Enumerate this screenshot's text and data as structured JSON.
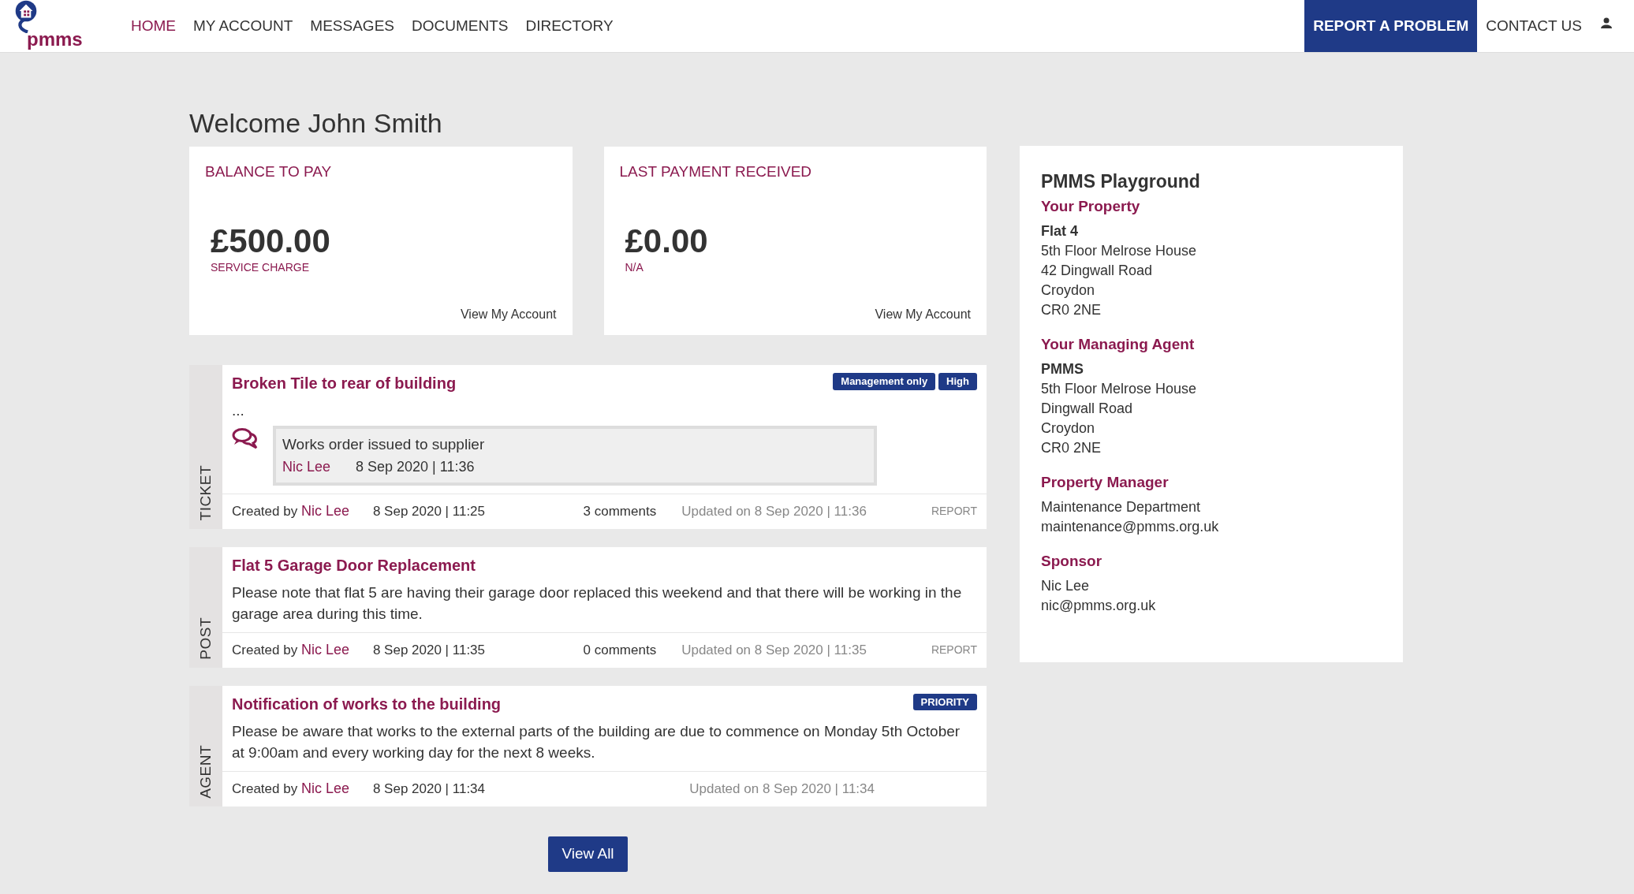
{
  "header": {
    "logo_text": "pmms",
    "nav": [
      {
        "label": "HOME",
        "selected": true
      },
      {
        "label": "MY ACCOUNT",
        "selected": false
      },
      {
        "label": "MESSAGES",
        "selected": false
      },
      {
        "label": "DOCUMENTS",
        "selected": false
      },
      {
        "label": "DIRECTORY",
        "selected": false
      }
    ],
    "report_button": "REPORT A PROBLEM",
    "contact_link": "CONTACT US"
  },
  "welcome": "Welcome John Smith",
  "summary_cards": [
    {
      "title": "BALANCE TO PAY",
      "amount": "£500.00",
      "caption": "SERVICE CHARGE",
      "link": "View My Account"
    },
    {
      "title": "LAST PAYMENT RECEIVED",
      "amount": "£0.00",
      "caption": "N/A",
      "link": "View My Account"
    }
  ],
  "feed": [
    {
      "type_label": "TICKET",
      "title": "Broken Tile to rear of building",
      "badges": [
        "Management only",
        "High"
      ],
      "body": "...",
      "comment": {
        "text": "Works order issued to supplier",
        "author": "Nic Lee",
        "time": "8 Sep 2020 | 11:36"
      },
      "created_prefix": "Created by",
      "author": "Nic Lee",
      "created": "8 Sep 2020 | 11:25",
      "comments": "3 comments",
      "updated": "Updated on 8 Sep 2020 | 11:36",
      "report": "REPORT"
    },
    {
      "type_label": "POST",
      "title": "Flat 5 Garage Door Replacement",
      "body": "Please note that flat 5 are having their garage door replaced this weekend and that there will be working in the garage area during this time.",
      "created_prefix": "Created by",
      "author": "Nic Lee",
      "created": "8 Sep 2020 | 11:35",
      "comments": "0 comments",
      "updated": "Updated on 8 Sep 2020 | 11:35",
      "report": "REPORT"
    },
    {
      "type_label": "AGENT",
      "title": "Notification of works to the building",
      "badges": [
        "PRIORITY"
      ],
      "body": "Please be aware that works to the external parts of the building are due to commence on Monday 5th October at 9:00am and every working day for the next 8 weeks.",
      "created_prefix": "Created by",
      "author": "Nic Lee",
      "created": "8 Sep 2020 | 11:34",
      "updated": "Updated on 8 Sep 2020 | 11:34"
    }
  ],
  "view_all_button": "View All",
  "sidebar": {
    "title": "PMMS Playground",
    "sections": [
      {
        "heading": "Your Property",
        "lines": [
          {
            "text": "Flat 4",
            "bold": true
          },
          {
            "text": "5th Floor Melrose House",
            "bold": false
          },
          {
            "text": "42 Dingwall Road",
            "bold": false
          },
          {
            "text": "Croydon",
            "bold": false
          },
          {
            "text": "CR0 2NE",
            "bold": false
          }
        ]
      },
      {
        "heading": "Your Managing Agent",
        "lines": [
          {
            "text": "PMMS",
            "bold": true
          },
          {
            "text": "5th Floor Melrose House",
            "bold": false
          },
          {
            "text": "Dingwall Road",
            "bold": false
          },
          {
            "text": "Croydon",
            "bold": false
          },
          {
            "text": "CR0 2NE",
            "bold": false
          }
        ]
      },
      {
        "heading": "Property Manager",
        "lines": [
          {
            "text": "Maintenance Department",
            "bold": false
          },
          {
            "text": "maintenance@pmms.org.uk",
            "bold": false
          }
        ]
      },
      {
        "heading": "Sponsor",
        "lines": [
          {
            "text": "Nic Lee",
            "bold": false
          },
          {
            "text": "nic@pmms.org.uk",
            "bold": false
          }
        ]
      }
    ]
  }
}
